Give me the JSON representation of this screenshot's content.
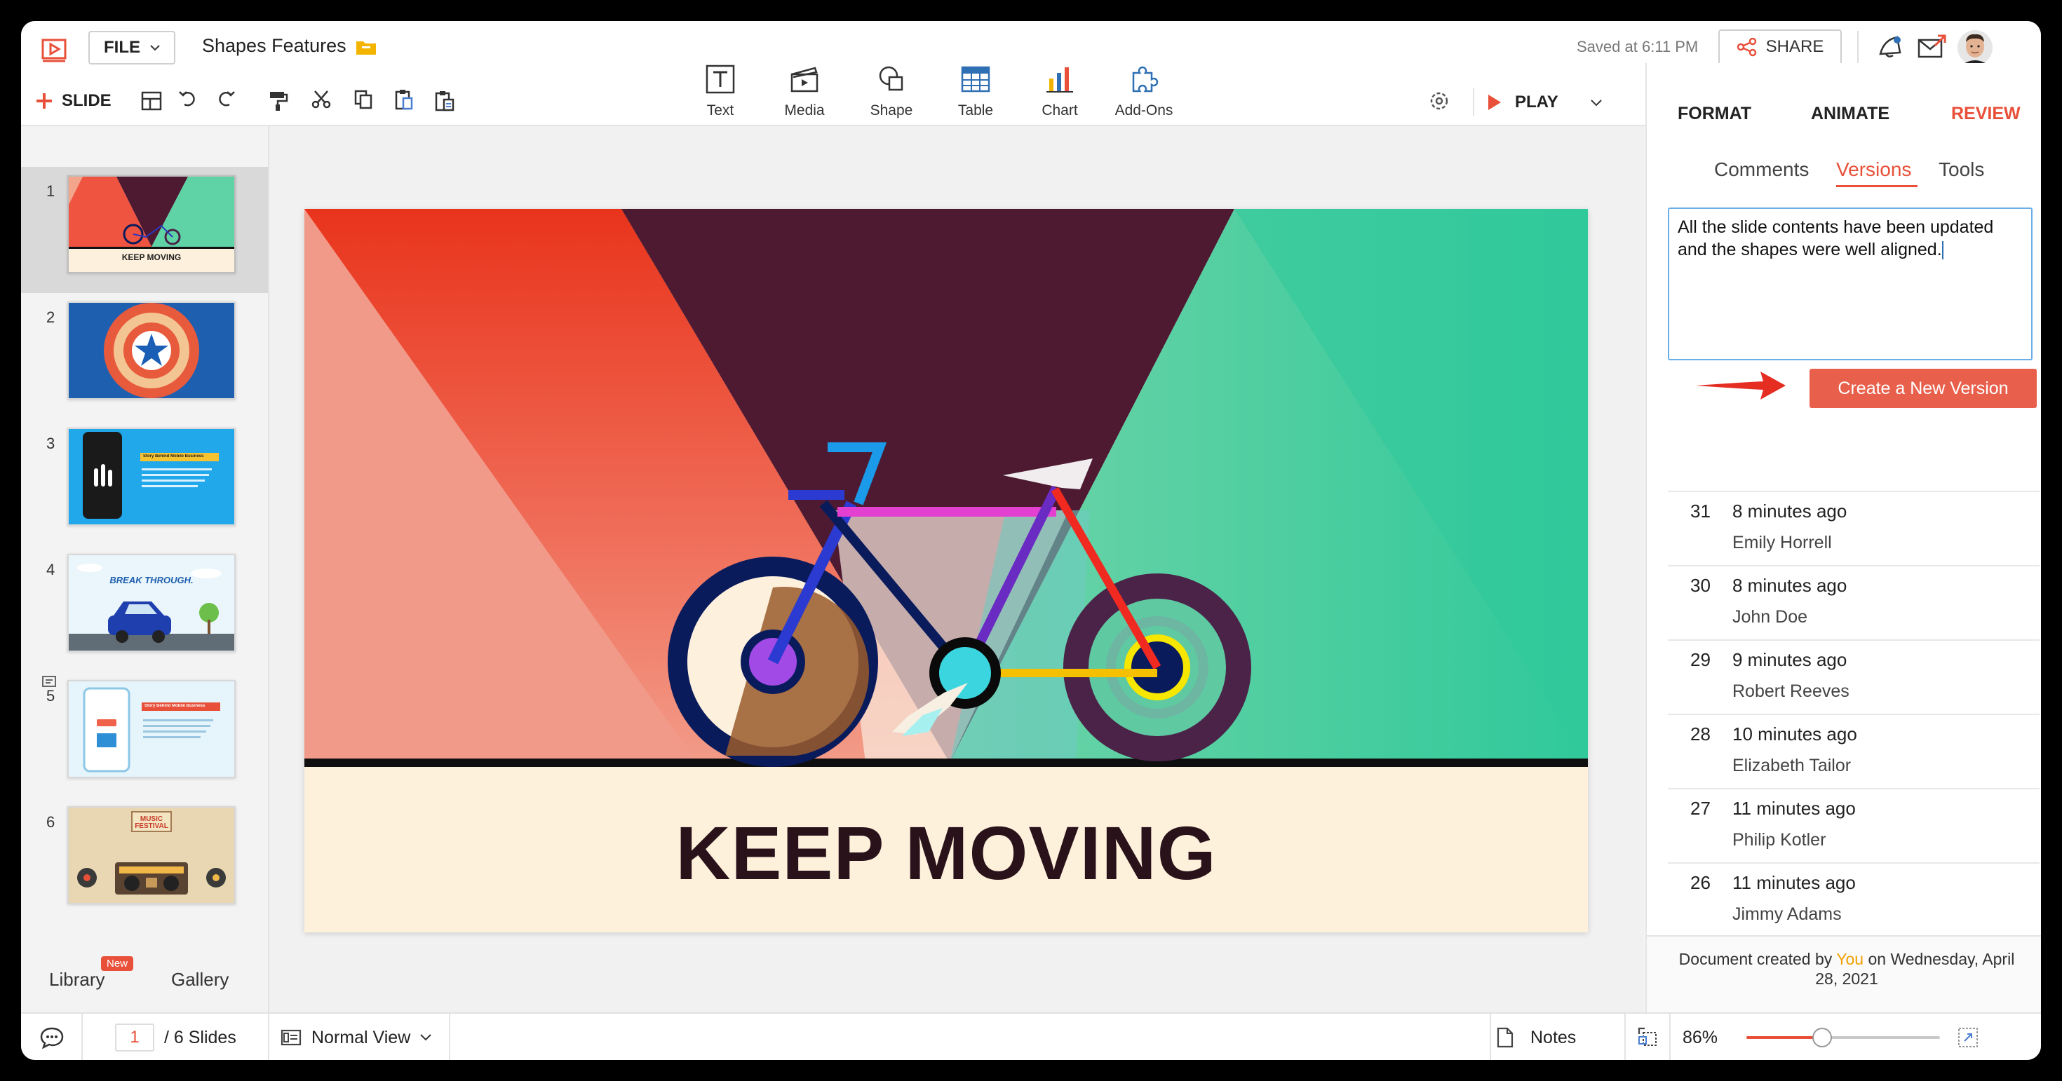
{
  "app": {
    "doc_title": "Shapes Features",
    "file_menu": "FILE",
    "saved_status": "Saved at 6:11 PM",
    "share_label": "SHARE",
    "slide_button": "SLIDE",
    "play_label": "PLAY"
  },
  "toolbar": {
    "items": [
      {
        "label": "Text",
        "icon": "text-icon"
      },
      {
        "label": "Media",
        "icon": "media-icon"
      },
      {
        "label": "Shape",
        "icon": "shape-icon"
      },
      {
        "label": "Table",
        "icon": "table-icon"
      },
      {
        "label": "Chart",
        "icon": "chart-icon"
      },
      {
        "label": "Add-Ons",
        "icon": "addons-icon"
      }
    ]
  },
  "panel_tabs": [
    {
      "label": "FORMAT",
      "active": false
    },
    {
      "label": "ANIMATE",
      "active": false
    },
    {
      "label": "REVIEW",
      "active": true
    }
  ],
  "review": {
    "subtabs": [
      {
        "label": "Comments",
        "active": false
      },
      {
        "label": "Versions",
        "active": true
      },
      {
        "label": "Tools",
        "active": false
      }
    ],
    "version_note": "All the slide contents have been updated and the shapes were well aligned.",
    "create_button": "Create a New Version",
    "versions": [
      {
        "number": "31",
        "time": "8 minutes ago",
        "author": "Emily Horrell"
      },
      {
        "number": "30",
        "time": "8 minutes ago",
        "author": "John Doe"
      },
      {
        "number": "29",
        "time": "9 minutes ago",
        "author": "Robert Reeves"
      },
      {
        "number": "28",
        "time": "10 minutes ago",
        "author": "Elizabeth Tailor"
      },
      {
        "number": "27",
        "time": "11 minutes ago",
        "author": "Philip Kotler"
      },
      {
        "number": "26",
        "time": "11 minutes ago",
        "author": "Jimmy Adams"
      }
    ],
    "created_prefix": "Document created by",
    "created_by": "You",
    "created_suffix": "on Wednesday, April 28, 2021"
  },
  "sidebar": {
    "slides": [
      {
        "number": "1",
        "title": "KEEP MOVING"
      },
      {
        "number": "2",
        "title": ""
      },
      {
        "number": "3",
        "title": "Story Behind Mobile Business"
      },
      {
        "number": "4",
        "title": "BREAK THROUGH."
      },
      {
        "number": "5",
        "title": "Story Behind Mobile Business"
      },
      {
        "number": "6",
        "title": "MUSIC FESTIVAL"
      }
    ],
    "library_label": "Library",
    "library_badge": "New",
    "gallery_label": "Gallery"
  },
  "slide": {
    "title": "KEEP MOVING"
  },
  "status": {
    "current_slide": "1",
    "total_slides": "/ 6 Slides",
    "view_mode": "Normal View",
    "notes_label": "Notes",
    "zoom": "86%",
    "zoom_fraction": 0.39
  },
  "colors": {
    "accent": "#e8503a",
    "create_button": "#e8604c",
    "active_tab": "#e8503a"
  }
}
